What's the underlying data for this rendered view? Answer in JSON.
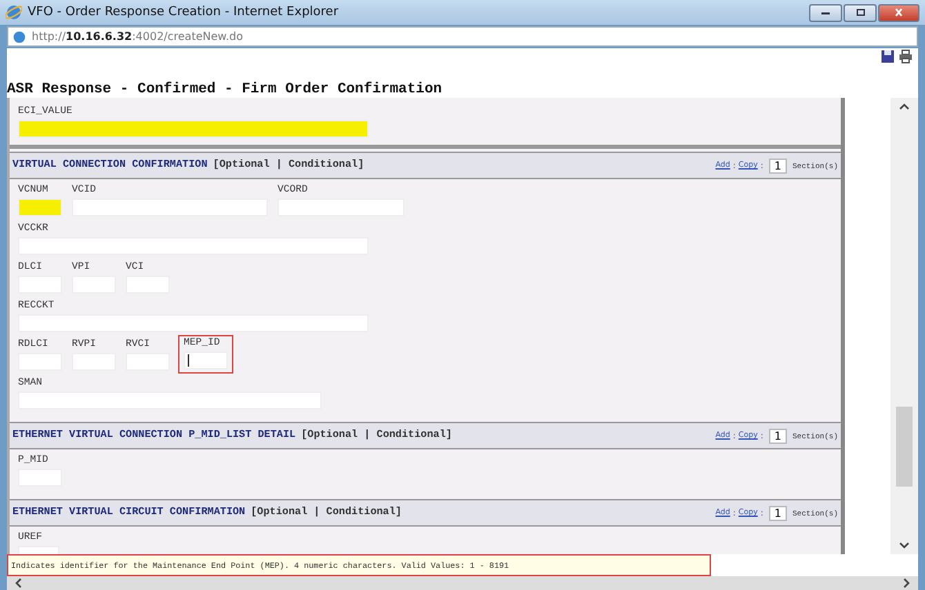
{
  "window": {
    "title": "VFO - Order Response Creation - Internet Explorer"
  },
  "address_bar": {
    "prefix": "http://",
    "host": "10.16.6.32",
    "rest": ":4002/createNew.do"
  },
  "page_title": "ASR Response - Confirmed - Firm Order Confirmation",
  "top_section": {
    "fields": [
      {
        "label": "ECI_VALUE",
        "required": true,
        "focused": false
      }
    ]
  },
  "sections": [
    {
      "title": "VIRTUAL CONNECTION CONFIRMATION",
      "tag": "[Optional | Conditional]",
      "add": "Add",
      "separator": ":",
      "copy": "Copy",
      "count": "1",
      "count_label": "Section(s)",
      "rows": [
        [
          {
            "label": "VCNUM",
            "required": true,
            "focused": false
          },
          {
            "label": "VCID",
            "required": false,
            "focused": false
          },
          {
            "label": "VCORD",
            "required": false,
            "focused": false
          }
        ],
        [
          {
            "label": "VCCKR",
            "required": false,
            "focused": false
          }
        ],
        [
          {
            "label": "DLCI",
            "required": false,
            "focused": false
          },
          {
            "label": "VPI",
            "required": false,
            "focused": false
          },
          {
            "label": "VCI",
            "required": false,
            "focused": false
          }
        ],
        [
          {
            "label": "RECCKT",
            "required": false,
            "focused": false
          }
        ],
        [
          {
            "label": "RDLCI",
            "required": false,
            "focused": false
          },
          {
            "label": "RVPI",
            "required": false,
            "focused": false
          },
          {
            "label": "RVCI",
            "required": false,
            "focused": false
          },
          {
            "label": "MEP_ID",
            "required": false,
            "focused": true
          }
        ],
        [
          {
            "label": "SMAN",
            "required": false,
            "focused": false
          }
        ]
      ]
    },
    {
      "title": "ETHERNET VIRTUAL CONNECTION P_MID_LIST DETAIL",
      "tag": "[Optional | Conditional]",
      "add": "Add",
      "separator": ":",
      "copy": "Copy",
      "count": "1",
      "count_label": "Section(s)",
      "rows": [
        [
          {
            "label": "P_MID",
            "required": false,
            "focused": false
          }
        ]
      ]
    },
    {
      "title": "ETHERNET VIRTUAL CIRCUIT CONFIRMATION",
      "tag": "[Optional | Conditional]",
      "add": "Add",
      "separator": ":",
      "copy": "Copy",
      "count": "1",
      "count_label": "Section(s)",
      "rows": [
        [
          {
            "label": "UREF",
            "required": false,
            "focused": false
          }
        ]
      ]
    }
  ],
  "status_text": "Indicates identifier for the Maintenance End Point (MEP). 4 numeric characters. Valid Values: 1 - 8191"
}
